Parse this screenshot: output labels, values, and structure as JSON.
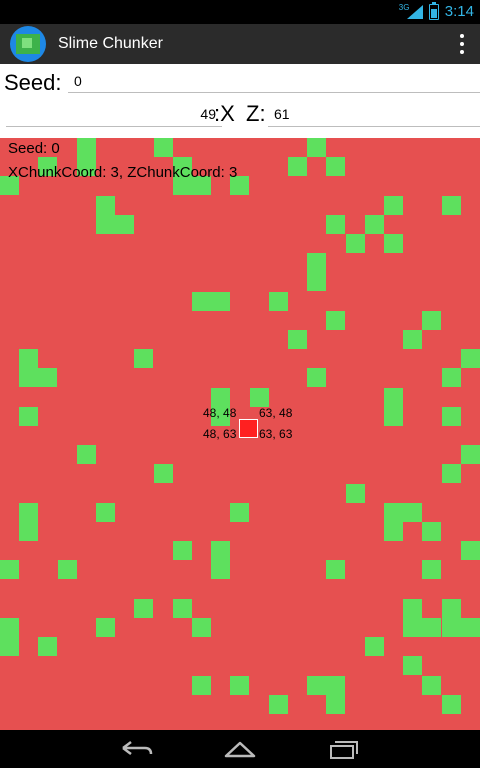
{
  "status_bar": {
    "signal_tag": "3G",
    "time": "3:14"
  },
  "action_bar": {
    "title": "Slime Chunker"
  },
  "form": {
    "seed_label": "Seed:",
    "seed_value": "0",
    "x_value": "49",
    "x_label": ":X",
    "z_label": "Z:",
    "z_value": "61"
  },
  "map": {
    "seed_text": "Seed: 0",
    "chunk_text": "XChunkCoord: 3, ZChunkCoord: 3",
    "labels": [
      "48, 48",
      "63, 48",
      "48, 63",
      "63, 63"
    ],
    "colors": {
      "background": "#e65050",
      "slime": "#5ee05e",
      "selected": "#ff2020"
    },
    "grid": {
      "cols": 25,
      "rows": 31
    },
    "slime_chunks": [
      [
        4,
        0
      ],
      [
        8,
        0
      ],
      [
        16,
        0
      ],
      [
        2,
        1
      ],
      [
        4,
        1
      ],
      [
        9,
        1
      ],
      [
        15,
        1
      ],
      [
        17,
        1
      ],
      [
        0,
        2
      ],
      [
        9,
        2
      ],
      [
        10,
        2
      ],
      [
        12,
        2
      ],
      [
        5,
        3
      ],
      [
        20,
        3
      ],
      [
        23,
        3
      ],
      [
        5,
        4
      ],
      [
        6,
        4
      ],
      [
        17,
        4
      ],
      [
        19,
        4
      ],
      [
        18,
        5
      ],
      [
        20,
        5
      ],
      [
        16,
        6
      ],
      [
        16,
        7
      ],
      [
        10,
        8
      ],
      [
        11,
        8
      ],
      [
        14,
        8
      ],
      [
        17,
        9
      ],
      [
        22,
        9
      ],
      [
        15,
        10
      ],
      [
        21,
        10
      ],
      [
        1,
        11
      ],
      [
        7,
        11
      ],
      [
        24,
        11
      ],
      [
        1,
        12
      ],
      [
        2,
        12
      ],
      [
        16,
        12
      ],
      [
        23,
        12
      ],
      [
        11,
        13
      ],
      [
        13,
        13
      ],
      [
        20,
        13
      ],
      [
        1,
        14
      ],
      [
        11,
        14
      ],
      [
        20,
        14
      ],
      [
        23,
        14
      ],
      [
        4,
        16
      ],
      [
        24,
        16
      ],
      [
        8,
        17
      ],
      [
        23,
        17
      ],
      [
        18,
        18
      ],
      [
        1,
        19
      ],
      [
        5,
        19
      ],
      [
        12,
        19
      ],
      [
        20,
        19
      ],
      [
        21,
        19
      ],
      [
        1,
        20
      ],
      [
        20,
        20
      ],
      [
        22,
        20
      ],
      [
        9,
        21
      ],
      [
        11,
        21
      ],
      [
        24,
        21
      ],
      [
        0,
        22
      ],
      [
        3,
        22
      ],
      [
        11,
        22
      ],
      [
        17,
        22
      ],
      [
        22,
        22
      ],
      [
        7,
        24
      ],
      [
        9,
        24
      ],
      [
        21,
        24
      ],
      [
        23,
        24
      ],
      [
        0,
        25
      ],
      [
        5,
        25
      ],
      [
        10,
        25
      ],
      [
        21,
        25
      ],
      [
        22,
        25
      ],
      [
        23,
        25
      ],
      [
        24,
        25
      ],
      [
        0,
        26
      ],
      [
        2,
        26
      ],
      [
        19,
        26
      ],
      [
        21,
        27
      ],
      [
        10,
        28
      ],
      [
        12,
        28
      ],
      [
        16,
        28
      ],
      [
        17,
        28
      ],
      [
        22,
        28
      ],
      [
        14,
        29
      ],
      [
        17,
        29
      ],
      [
        23,
        29
      ]
    ]
  }
}
